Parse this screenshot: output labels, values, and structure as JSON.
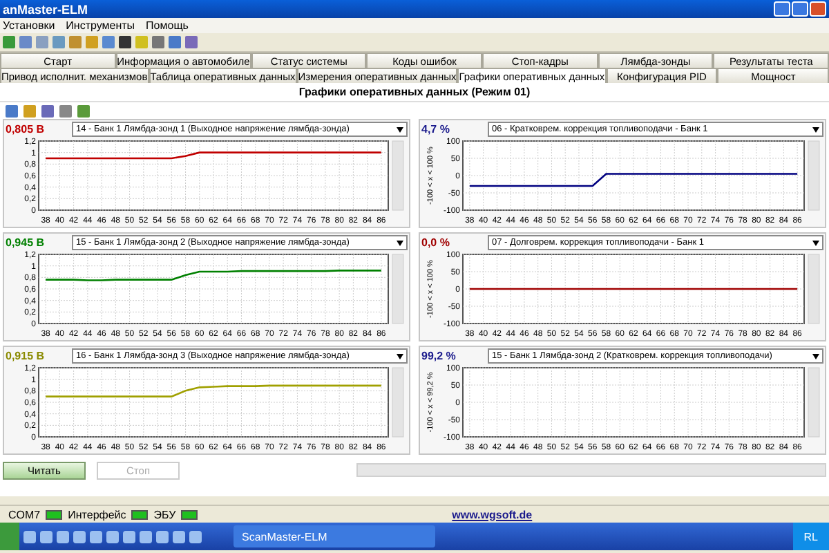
{
  "window": {
    "title": "anMaster-ELM"
  },
  "menu": [
    {
      "label": "Установки"
    },
    {
      "label": "Инструменты"
    },
    {
      "label": "Помощь"
    }
  ],
  "tab_rows": [
    [
      {
        "label": "Старт",
        "selected": false
      },
      {
        "label": "Информация о автомобиле",
        "selected": false
      },
      {
        "label": "Статус системы",
        "selected": false
      },
      {
        "label": "Коды ошибок",
        "selected": false
      },
      {
        "label": "Стоп-кадры",
        "selected": false
      },
      {
        "label": "Лямбда-зонды",
        "selected": false
      },
      {
        "label": "Результаты теста",
        "selected": false
      }
    ],
    [
      {
        "label": "Привод исполнит. механизмов",
        "selected": false
      },
      {
        "label": "Таблица оперативных данных",
        "selected": false
      },
      {
        "label": "Измерения оперативных данных",
        "selected": false
      },
      {
        "label": "Графики оперативных данных",
        "selected": true
      },
      {
        "label": "Конфигурация PID",
        "selected": false
      },
      {
        "label": "Мощност",
        "selected": false
      }
    ]
  ],
  "page_title": "Графики оперативных данных (Режим 01)",
  "panels": [
    {
      "reading": "0,805 В",
      "color": "#c00000",
      "pid": "14 - Банк 1 Лямбда-зонд 1 (Выходное напряжение лямбда-зонда)",
      "chart_data": {
        "type": "line",
        "grid": true,
        "x": [
          38,
          40,
          42,
          44,
          46,
          48,
          50,
          52,
          54,
          56,
          58,
          60,
          62,
          64,
          66,
          68,
          70,
          72,
          74,
          76,
          78,
          80,
          82,
          84,
          86
        ],
        "xlim": [
          37,
          87
        ],
        "xticks": [
          38,
          40,
          42,
          44,
          46,
          48,
          50,
          52,
          54,
          56,
          58,
          60,
          62,
          64,
          66,
          68,
          70,
          72,
          74,
          76,
          78,
          80,
          82,
          84,
          86
        ],
        "ylim": [
          0,
          1.2
        ],
        "yticks": [
          0,
          {
            "value": 0.2,
            "label": "0,2"
          },
          {
            "value": 0.4,
            "label": "0,4"
          },
          {
            "value": 0.6,
            "label": "0,6"
          },
          {
            "value": 0.8,
            "label": "0,8"
          },
          1,
          {
            "value": 1.2,
            "label": "1,2"
          }
        ],
        "series": [
          {
            "color": "#c00000",
            "values": [
              0.9,
              0.9,
              0.9,
              0.9,
              0.9,
              0.9,
              0.9,
              0.9,
              0.9,
              0.9,
              0.94,
              1.0,
              1.0,
              1.0,
              1.0,
              1.0,
              1.0,
              1.0,
              1.0,
              1.0,
              1.0,
              1.0,
              1.0,
              1.0,
              1.0
            ]
          }
        ]
      }
    },
    {
      "reading": "4,7 %",
      "color": "#1a1a8c",
      "pid": "06 - Кратковрем. коррекция топливоподачи - Банк 1",
      "axis_label": "-100 < x < 100 %",
      "chart_data": {
        "type": "line",
        "grid": true,
        "x": [
          38,
          40,
          42,
          44,
          46,
          48,
          50,
          52,
          54,
          56,
          58,
          60,
          62,
          64,
          66,
          68,
          70,
          72,
          74,
          76,
          78,
          80,
          82,
          84,
          86
        ],
        "xlim": [
          37,
          87
        ],
        "xticks": [
          38,
          40,
          42,
          44,
          46,
          48,
          50,
          52,
          54,
          56,
          58,
          60,
          62,
          64,
          66,
          68,
          70,
          72,
          74,
          76,
          78,
          80,
          82,
          84,
          86
        ],
        "ylim": [
          -100,
          100
        ],
        "yticks": [
          -100,
          -50,
          0,
          50,
          100
        ],
        "series": [
          {
            "color": "#000080",
            "values": [
              -30,
              -30,
              -30,
              -30,
              -30,
              -30,
              -30,
              -30,
              -30,
              -30,
              5,
              5,
              5,
              5,
              5,
              5,
              5,
              5,
              5,
              5,
              5,
              5,
              5,
              5,
              5
            ]
          }
        ]
      }
    },
    {
      "reading": "0,945 В",
      "color": "#008000",
      "pid": "15 - Банк 1 Лямбда-зонд 2 (Выходное напряжение лямбда-зонда)",
      "chart_data": {
        "type": "line",
        "grid": true,
        "x": [
          38,
          40,
          42,
          44,
          46,
          48,
          50,
          52,
          54,
          56,
          58,
          60,
          62,
          64,
          66,
          68,
          70,
          72,
          74,
          76,
          78,
          80,
          82,
          84,
          86
        ],
        "xlim": [
          37,
          87
        ],
        "xticks": [
          38,
          40,
          42,
          44,
          46,
          48,
          50,
          52,
          54,
          56,
          58,
          60,
          62,
          64,
          66,
          68,
          70,
          72,
          74,
          76,
          78,
          80,
          82,
          84,
          86
        ],
        "ylim": [
          0,
          1.2
        ],
        "yticks": [
          0,
          {
            "value": 0.2,
            "label": "0,2"
          },
          {
            "value": 0.4,
            "label": "0,4"
          },
          {
            "value": 0.6,
            "label": "0,6"
          },
          {
            "value": 0.8,
            "label": "0,8"
          },
          1,
          {
            "value": 1.2,
            "label": "1,2"
          }
        ],
        "series": [
          {
            "color": "#008000",
            "values": [
              0.76,
              0.76,
              0.76,
              0.75,
              0.75,
              0.76,
              0.76,
              0.76,
              0.76,
              0.76,
              0.84,
              0.9,
              0.9,
              0.9,
              0.91,
              0.91,
              0.91,
              0.91,
              0.91,
              0.91,
              0.91,
              0.92,
              0.92,
              0.92,
              0.92
            ]
          }
        ]
      }
    },
    {
      "reading": "0,0 %",
      "color": "#a00000",
      "pid": "07 - Долговрем. коррекция топливоподачи - Банк 1",
      "axis_label": "-100 < x < 100 %",
      "chart_data": {
        "type": "line",
        "grid": true,
        "x": [
          38,
          40,
          42,
          44,
          46,
          48,
          50,
          52,
          54,
          56,
          58,
          60,
          62,
          64,
          66,
          68,
          70,
          72,
          74,
          76,
          78,
          80,
          82,
          84,
          86
        ],
        "xlim": [
          37,
          87
        ],
        "xticks": [
          38,
          40,
          42,
          44,
          46,
          48,
          50,
          52,
          54,
          56,
          58,
          60,
          62,
          64,
          66,
          68,
          70,
          72,
          74,
          76,
          78,
          80,
          82,
          84,
          86
        ],
        "ylim": [
          -100,
          100
        ],
        "yticks": [
          -100,
          -50,
          0,
          50,
          100
        ],
        "series": [
          {
            "color": "#a00000",
            "values": [
              0,
              0,
              0,
              0,
              0,
              0,
              0,
              0,
              0,
              0,
              0,
              0,
              0,
              0,
              0,
              0,
              0,
              0,
              0,
              0,
              0,
              0,
              0,
              0,
              0
            ]
          }
        ]
      }
    },
    {
      "reading": "0,915 В",
      "color": "#8a8a00",
      "pid": "16 - Банк 1 Лямбда-зонд 3 (Выходное напряжение лямбда-зонда)",
      "chart_data": {
        "type": "line",
        "grid": true,
        "x": [
          38,
          40,
          42,
          44,
          46,
          48,
          50,
          52,
          54,
          56,
          58,
          60,
          62,
          64,
          66,
          68,
          70,
          72,
          74,
          76,
          78,
          80,
          82,
          84,
          86
        ],
        "xlim": [
          37,
          87
        ],
        "xticks": [
          38,
          40,
          42,
          44,
          46,
          48,
          50,
          52,
          54,
          56,
          58,
          60,
          62,
          64,
          66,
          68,
          70,
          72,
          74,
          76,
          78,
          80,
          82,
          84,
          86
        ],
        "ylim": [
          0,
          1.2
        ],
        "yticks": [
          0,
          {
            "value": 0.2,
            "label": "0,2"
          },
          {
            "value": 0.4,
            "label": "0,4"
          },
          {
            "value": 0.6,
            "label": "0,6"
          },
          {
            "value": 0.8,
            "label": "0,8"
          },
          1,
          {
            "value": 1.2,
            "label": "1,2"
          }
        ],
        "series": [
          {
            "color": "#a0a000",
            "values": [
              0.7,
              0.7,
              0.7,
              0.7,
              0.7,
              0.7,
              0.7,
              0.7,
              0.7,
              0.7,
              0.8,
              0.86,
              0.87,
              0.88,
              0.88,
              0.88,
              0.89,
              0.89,
              0.89,
              0.89,
              0.89,
              0.89,
              0.89,
              0.89,
              0.89
            ]
          }
        ]
      }
    },
    {
      "reading": "99,2 %",
      "color": "#1a1a8c",
      "pid": "15 - Банк 1 Лямбда-зонд 2 (Кратковрем. коррекция топливоподачи)",
      "axis_label": "-100 < x < 99,2 %",
      "chart_data": {
        "type": "line",
        "grid": true,
        "xlim": [
          37,
          87
        ],
        "xticks": [
          38,
          40,
          42,
          44,
          46,
          48,
          50,
          52,
          54,
          56,
          58,
          60,
          62,
          64,
          66,
          68,
          70,
          72,
          74,
          76,
          78,
          80,
          82,
          84,
          86
        ],
        "ylim": [
          -100,
          100
        ],
        "yticks": [
          -100,
          -50,
          0,
          50,
          100
        ]
      }
    }
  ],
  "buttons": [
    {
      "label": "Читать",
      "disabled": false
    },
    {
      "label": "Стоп",
      "disabled": true
    }
  ],
  "progress": {
    "level": 0
  },
  "status_bar": {
    "indicators": [
      {
        "label": "COM7",
        "on": true
      },
      {
        "label": "Интерфейс",
        "on": true
      },
      {
        "label": "ЭБУ",
        "on": true
      }
    ],
    "link": "www.wgsoft.de"
  },
  "taskbar": {
    "task": "ScanMaster-ELM",
    "tray_language": "RL"
  }
}
